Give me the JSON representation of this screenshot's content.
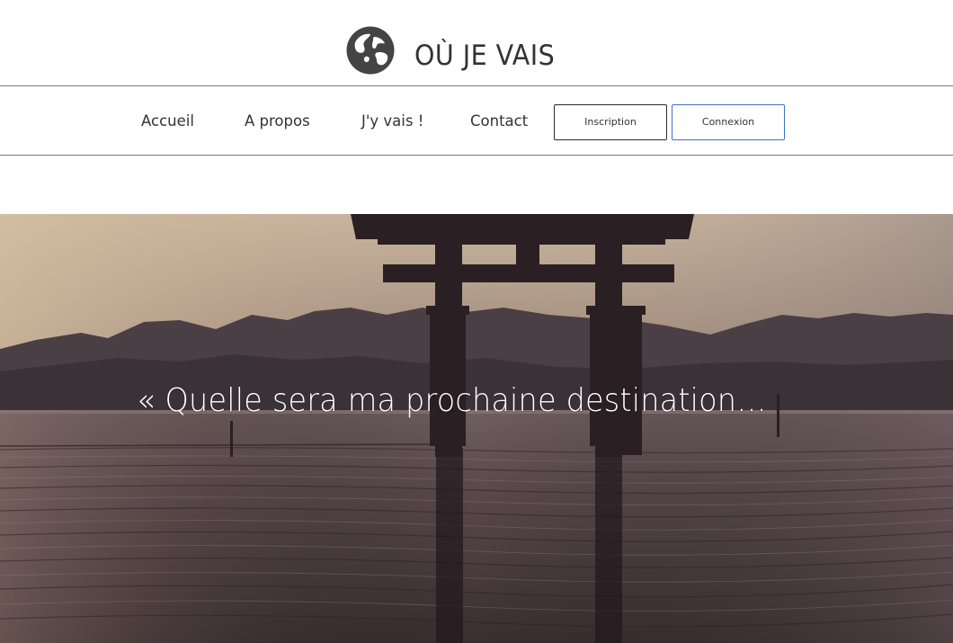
{
  "site": {
    "title": "OÙ JE VAIS",
    "logo_icon": "globe-icon"
  },
  "nav": {
    "links": [
      "Accueil",
      "A propos",
      "J'y vais !",
      "Contact"
    ],
    "inscription_label": "Inscription",
    "connexion_label": "Connexion"
  },
  "hero": {
    "quote": "« Quelle sera ma prochaine destination…",
    "image_subject": "torii-gate-sunset-photo"
  },
  "colors": {
    "text": "#333333",
    "divider": "#7a7a7a",
    "connexion_border": "#3a72c8",
    "inscription_border": "#2a2a2a"
  }
}
